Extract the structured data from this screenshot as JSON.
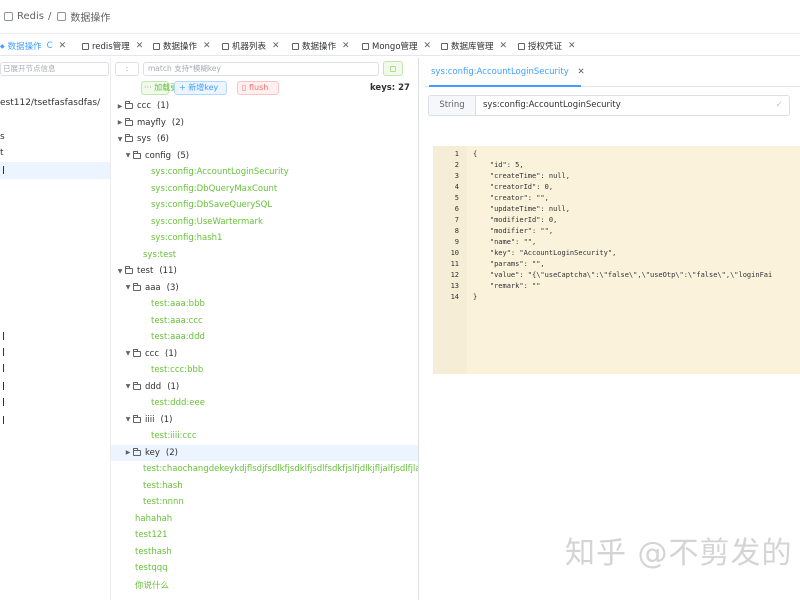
{
  "breadcrumb": {
    "root": "Redis",
    "sep": "/",
    "current": "数据操作"
  },
  "tabs": [
    {
      "label": "数据操作",
      "active": true,
      "refresh": "C"
    },
    {
      "label": "redis管理"
    },
    {
      "label": "数据操作"
    },
    {
      "label": "机器列表"
    },
    {
      "label": "数据操作"
    },
    {
      "label": "Mongo管理"
    },
    {
      "label": "数据库管理"
    },
    {
      "label": "授权凭证"
    }
  ],
  "close_glyph": "✕",
  "left": {
    "filter_placeholder": "已展开节点信息",
    "path_text": "est112/tsetfasfasdfas/",
    "marks": [
      "s",
      "t"
    ]
  },
  "mid": {
    "db_select": ":",
    "match_placeholder": "match 支持*模糊key",
    "search_icon": "magnifier",
    "btn_more": "加载更多",
    "btn_add": "新增key",
    "btn_flush": "flush",
    "keys_count": "keys: 27",
    "tree": [
      {
        "depth": 0,
        "arrow": "▶",
        "folder": true,
        "label": "ccc",
        "count": "(1)"
      },
      {
        "depth": 0,
        "arrow": "▶",
        "folder": true,
        "label": "mayfly",
        "count": "(2)"
      },
      {
        "depth": 0,
        "arrow": "▼",
        "folder": true,
        "label": "sys",
        "count": "(6)"
      },
      {
        "depth": 1,
        "arrow": "▼",
        "folder": true,
        "label": "config",
        "count": "(5)"
      },
      {
        "depth": 2,
        "leaf": true,
        "label": "sys:config:AccountLoginSecurity"
      },
      {
        "depth": 2,
        "leaf": true,
        "label": "sys:config:DbQueryMaxCount"
      },
      {
        "depth": 2,
        "leaf": true,
        "label": "sys:config:DbSaveQuerySQL"
      },
      {
        "depth": 2,
        "leaf": true,
        "label": "sys:config:UseWartermark"
      },
      {
        "depth": 2,
        "leaf": true,
        "label": "sys:config:hash1"
      },
      {
        "depth": 1,
        "leaf": true,
        "label": "sys:test"
      },
      {
        "depth": 0,
        "arrow": "▼",
        "folder": true,
        "label": "test",
        "count": "(11)"
      },
      {
        "depth": 1,
        "arrow": "▼",
        "folder": true,
        "label": "aaa",
        "count": "(3)"
      },
      {
        "depth": 2,
        "leaf": true,
        "label": "test:aaa:bbb"
      },
      {
        "depth": 2,
        "leaf": true,
        "label": "test:aaa:ccc"
      },
      {
        "depth": 2,
        "leaf": true,
        "label": "test:aaa:ddd"
      },
      {
        "depth": 1,
        "arrow": "▼",
        "folder": true,
        "label": "ccc",
        "count": "(1)"
      },
      {
        "depth": 2,
        "leaf": true,
        "label": "test:ccc:bbb"
      },
      {
        "depth": 1,
        "arrow": "▼",
        "folder": true,
        "label": "ddd",
        "count": "(1)"
      },
      {
        "depth": 2,
        "leaf": true,
        "label": "test:ddd:eee"
      },
      {
        "depth": 1,
        "arrow": "▼",
        "folder": true,
        "label": "iiii",
        "count": "(1)"
      },
      {
        "depth": 2,
        "leaf": true,
        "label": "test:iiii:ccc"
      },
      {
        "depth": 1,
        "arrow": "▶",
        "folder": true,
        "label": "key",
        "count": "(2)",
        "selected": true
      },
      {
        "depth": 1,
        "leaf": true,
        "label": "test:chaochangdekeykdjflsdjfsdlkfjsdklfjsdlfsdkfjslfjdlkjfljalfjsdlfjlasdjfl"
      },
      {
        "depth": 1,
        "leaf": true,
        "label": "test:hash"
      },
      {
        "depth": 1,
        "leaf": true,
        "label": "test:nnnn"
      },
      {
        "depth": 0,
        "leaf": true,
        "label": "hahahah"
      },
      {
        "depth": 0,
        "leaf": true,
        "label": "test121"
      },
      {
        "depth": 0,
        "leaf": true,
        "label": "testhash"
      },
      {
        "depth": 0,
        "leaf": true,
        "label": "testqqq"
      },
      {
        "depth": 0,
        "leaf": true,
        "label": "你说什么"
      }
    ]
  },
  "detail": {
    "tab_label": "sys:config:AccountLoginSecurity",
    "type": "String",
    "key_value": "sys:config:AccountLoginSecurity",
    "check_glyph": "✓",
    "line_numbers": [
      "1",
      "2",
      "3",
      "4",
      "5",
      "6",
      "7",
      "8",
      "9",
      "10",
      "11",
      "12",
      "13",
      "14"
    ],
    "code_lines": [
      "{",
      "    \"id\": 5,",
      "    \"createTime\": null,",
      "    \"creatorId\": 0,",
      "    \"creator\": \"\",",
      "    \"updateTime\": null,",
      "    \"modifierId\": 0,",
      "    \"modifier\": \"\",",
      "    \"name\": \"\",",
      "    \"key\": \"AccountLoginSecurity\",",
      "    \"params\": \"\",",
      "    \"value\": \"{\\\"useCaptcha\\\":\\\"false\\\",\\\"useOtp\\\":\\\"false\\\",\\\"loginFai",
      "    \"remark\": \"\"",
      "}"
    ]
  },
  "watermark": "知乎 @不剪发的"
}
